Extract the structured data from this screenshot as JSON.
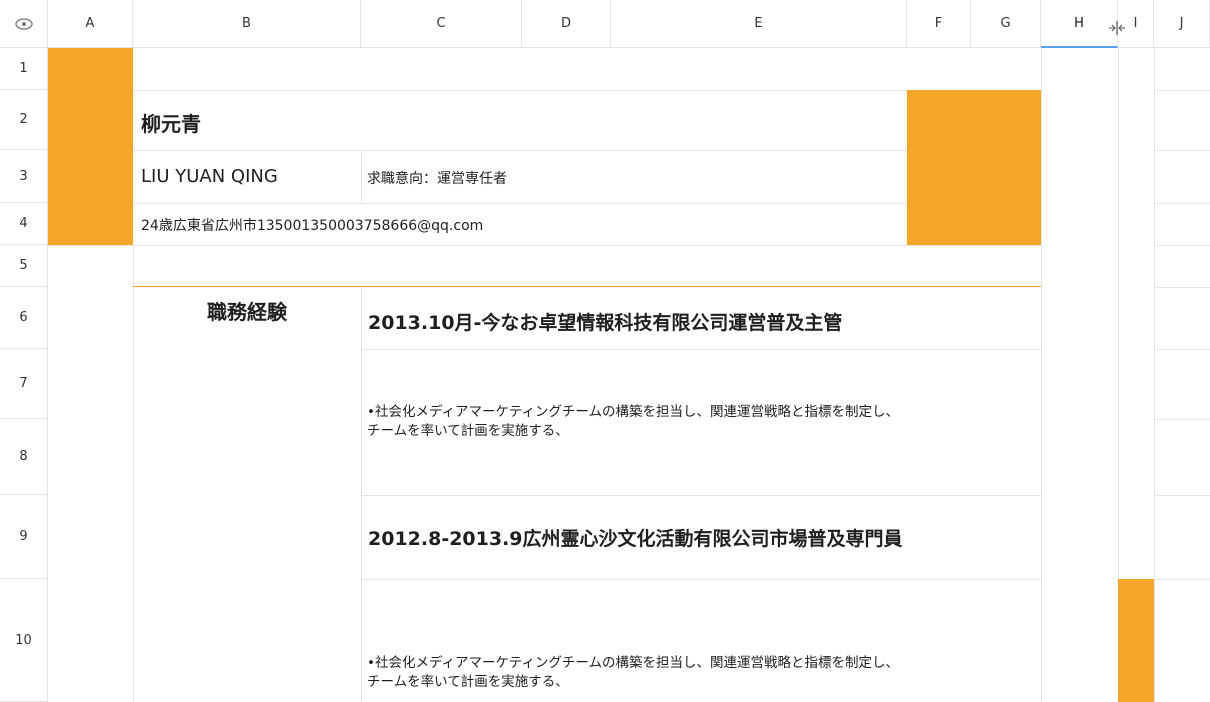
{
  "column_headers": [
    "A",
    "B",
    "C",
    "D",
    "E",
    "F",
    "G",
    "H",
    "I",
    "J"
  ],
  "row_headers": [
    "1",
    "2",
    "3",
    "4",
    "5",
    "6",
    "7",
    "8",
    "9",
    "10"
  ],
  "accent_color": "#f4a62a",
  "resume": {
    "name": "柳元青",
    "name_romaji": "LIU YUAN QING",
    "job_intention": "求職意向：運営専任者",
    "info_line": "24歳広東省広州市135001350003758666@qq.com",
    "section_title": "職務経験",
    "jobs": [
      {
        "title": "2013.10月-今なお卓望情報科技有限公司運営普及主管",
        "desc_line1": "•社会化メディアマーケティングチームの構築を担当し、関連運営戦略と指標を制定し、",
        "desc_line2": "チームを率いて計画を実施する、"
      },
      {
        "title": "2012.8-2013.9広州霊心沙文化活動有限公司市場普及専門員",
        "desc_line1": "•社会化メディアマーケティングチームの構築を担当し、関連運営戦略と指標を制定し、",
        "desc_line2": "チームを率いて計画を実施する、"
      }
    ]
  }
}
